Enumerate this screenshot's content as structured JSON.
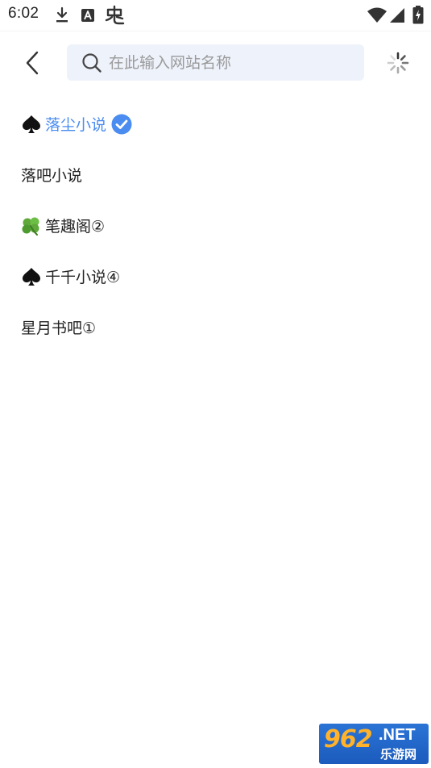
{
  "status_bar": {
    "time": "6:02",
    "icons": [
      "download-icon",
      "a-icon",
      "app-icon",
      "wifi-icon",
      "signal-icon",
      "battery-icon"
    ]
  },
  "header": {
    "back_icon": "chevron-left-icon",
    "search": {
      "placeholder": "在此输入网站名称",
      "value": ""
    },
    "loading_icon": "spinner-icon"
  },
  "sites": [
    {
      "label": "落尘小说",
      "prefix_icon": "spade-icon",
      "selected": true,
      "color": "#4a8cf0"
    },
    {
      "label": "落吧小说",
      "prefix_icon": "",
      "selected": false
    },
    {
      "label": "笔趣阁②",
      "prefix_icon": "clover-icon",
      "selected": false
    },
    {
      "label": "千千小说④",
      "prefix_icon": "spade-icon",
      "selected": false
    },
    {
      "label": "星月书吧①",
      "prefix_icon": "",
      "selected": false
    }
  ],
  "watermark": {
    "logo_number": "962",
    "logo_suffix": ".NET",
    "logo_cn": "乐游网"
  }
}
